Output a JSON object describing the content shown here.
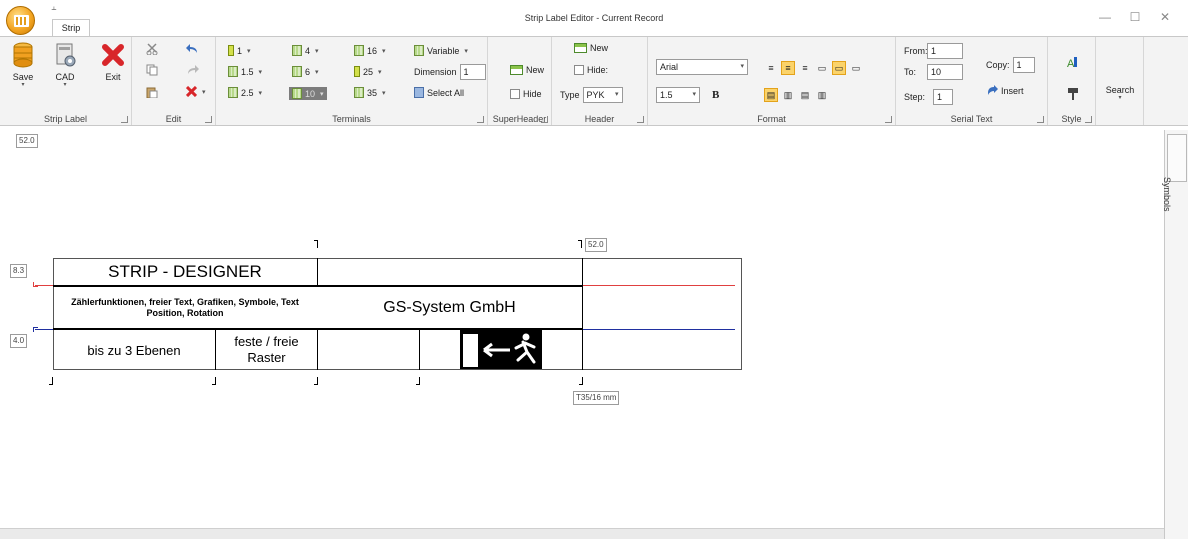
{
  "window": {
    "title": "Strip Label Editor - Current Record",
    "qat_glyph": "⫠",
    "minimize": "—",
    "maximize": "☐",
    "close": "✕"
  },
  "tabs": {
    "active": "Strip"
  },
  "ribbon": {
    "strip_label": {
      "label": "Strip Label",
      "save": "Save",
      "cad": "CAD",
      "exit": "Exit"
    },
    "edit": {
      "label": "Edit"
    },
    "terminals": {
      "label": "Terminals",
      "sizes": [
        "1",
        "1.5",
        "2.5",
        "4",
        "6",
        "10",
        "16",
        "25",
        "35"
      ],
      "variable": "Variable",
      "dimension_label": "Dimension",
      "dimension_value": "1",
      "select_all": "Select All"
    },
    "superheader": {
      "label": "SuperHeader",
      "new": "New",
      "hide": "Hide"
    },
    "header": {
      "label": "Header",
      "new": "New",
      "hide": "Hide:",
      "type_label": "Type",
      "type_value": "PYK"
    },
    "format": {
      "label": "Format",
      "font": "Arial",
      "size": "1.5",
      "bold": "B"
    },
    "serial_text": {
      "label": "Serial Text",
      "from_label": "From:",
      "from_value": "1",
      "to_label": "To:",
      "to_value": "10",
      "step_label": "Step:",
      "step_value": "1",
      "copy_label": "Copy:",
      "copy_value": "1",
      "insert": "Insert"
    },
    "style": {
      "label": "Style"
    },
    "search": {
      "label": "Search"
    }
  },
  "sidebar": {
    "symbols": "Symbols"
  },
  "canvas": {
    "top_length": "52.0",
    "header_length": "52.0",
    "row1_height": "8.3",
    "row2_height": "4.0",
    "rail": "T35/16 mm",
    "cells": {
      "strip_designer": "STRIP - DESIGNER",
      "features": "Zählerfunktionen, freier Text, Grafiken, Symbole, Text Position, Rotation",
      "company": "GS-System GmbH",
      "levels": "bis zu 3 Ebenen",
      "grid_line1": "feste / freie",
      "grid_line2": "Raster"
    },
    "colors": {
      "red_line": "#e04040",
      "blue_line": "#2030a0",
      "sign_bg": "#000000"
    }
  }
}
